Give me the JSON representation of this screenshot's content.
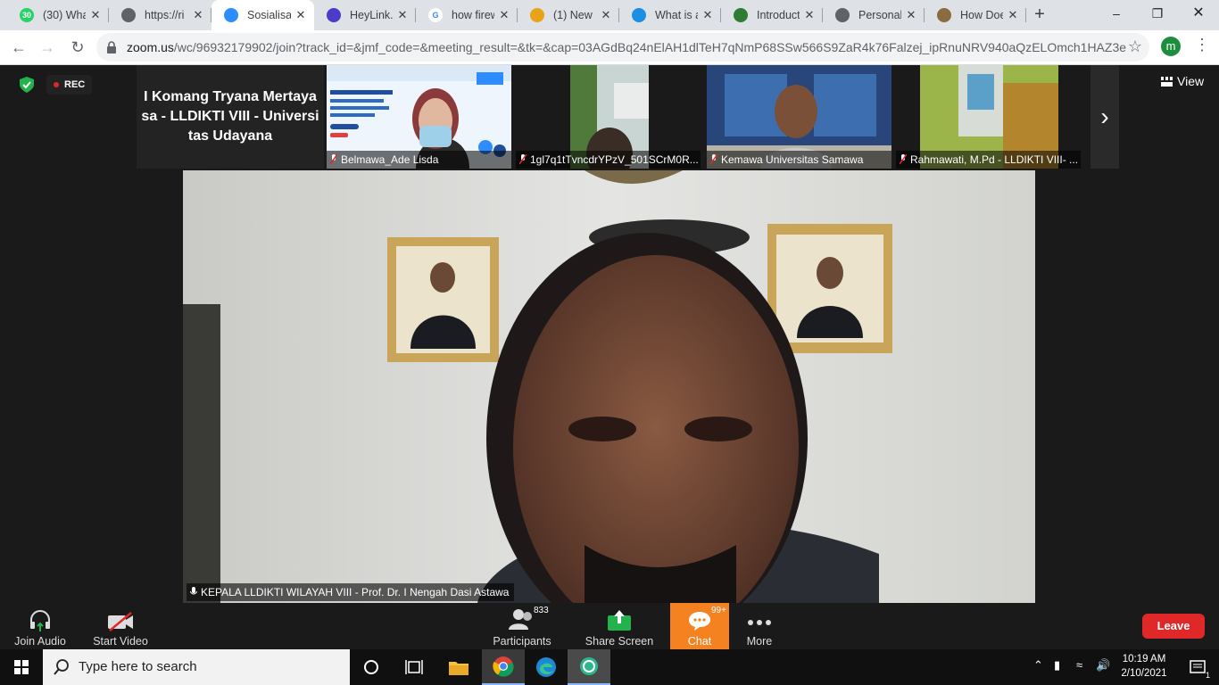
{
  "browser": {
    "tabs": [
      {
        "title": "(30) Wha",
        "favicon": "whatsapp-icon",
        "color": "#25d366",
        "favicon_text": "30"
      },
      {
        "title": "https://ri",
        "favicon": "globe-icon",
        "color": "#5f6368",
        "favicon_text": ""
      },
      {
        "title": "Sosialisas",
        "favicon": "zoom-icon",
        "color": "#2d8cff",
        "favicon_text": "",
        "active": true
      },
      {
        "title": "HeyLink.r",
        "favicon": "heylink-icon",
        "color": "#4a3cc8",
        "favicon_text": ""
      },
      {
        "title": "how firew",
        "favicon": "google-icon",
        "color": "#ffffff",
        "favicon_text": "G"
      },
      {
        "title": "(1) New N",
        "favicon": "pinterest-icon",
        "color": "#e8a317",
        "favicon_text": ""
      },
      {
        "title": "What is a",
        "favicon": "att-icon",
        "color": "#1a8fe3",
        "favicon_text": ""
      },
      {
        "title": "Introduct",
        "favicon": "trinket-icon",
        "color": "#2e7d32",
        "favicon_text": ""
      },
      {
        "title": "Personali",
        "favicon": "globe-icon",
        "color": "#5f6368",
        "favicon_text": ""
      },
      {
        "title": "How Doe",
        "favicon": "owl-icon",
        "color": "#8b6b3f",
        "favicon_text": ""
      }
    ],
    "url_host": "zoom.us",
    "url_path": "/wc/96932179902/join?track_id=&jmf_code=&meeting_result=&tk=&cap=03AGdBq24nElAH1dlTeH7qNmP68SSw566S9ZaR4k76Falzej_ipRnuNRV940aQzELOmch1HAZ3e...",
    "profile_initial": "m"
  },
  "zoom": {
    "rec_label": "REC",
    "view_label": "View",
    "thumb_name_only": "I Komang Tryana Mertaya sa - LLDIKTI VIII - Universi tas Udayana",
    "thumbs": [
      {
        "name": "Belmawa_Ade Lisda"
      },
      {
        "name": "1gl7q1tTvncdrYPzV_501SCrM0R..."
      },
      {
        "name": "Kemawa Universitas Samawa"
      },
      {
        "name": "Rahmawati, M.Pd - LLDIKTI VIII- ..."
      }
    ],
    "speaker_name": "KEPALA LLDIKTI WILAYAH VIII - Prof. Dr. I Nengah Dasi Astawa",
    "controls": {
      "join_audio": "Join Audio",
      "start_video": "Start Video",
      "participants": "Participants",
      "participants_count": "833",
      "share_screen": "Share Screen",
      "chat": "Chat",
      "chat_badge": "99+",
      "more": "More",
      "leave": "Leave"
    }
  },
  "taskbar": {
    "search_placeholder": "Type here to search",
    "time": "10:19 AM",
    "date": "2/10/2021",
    "notifications": "1"
  }
}
